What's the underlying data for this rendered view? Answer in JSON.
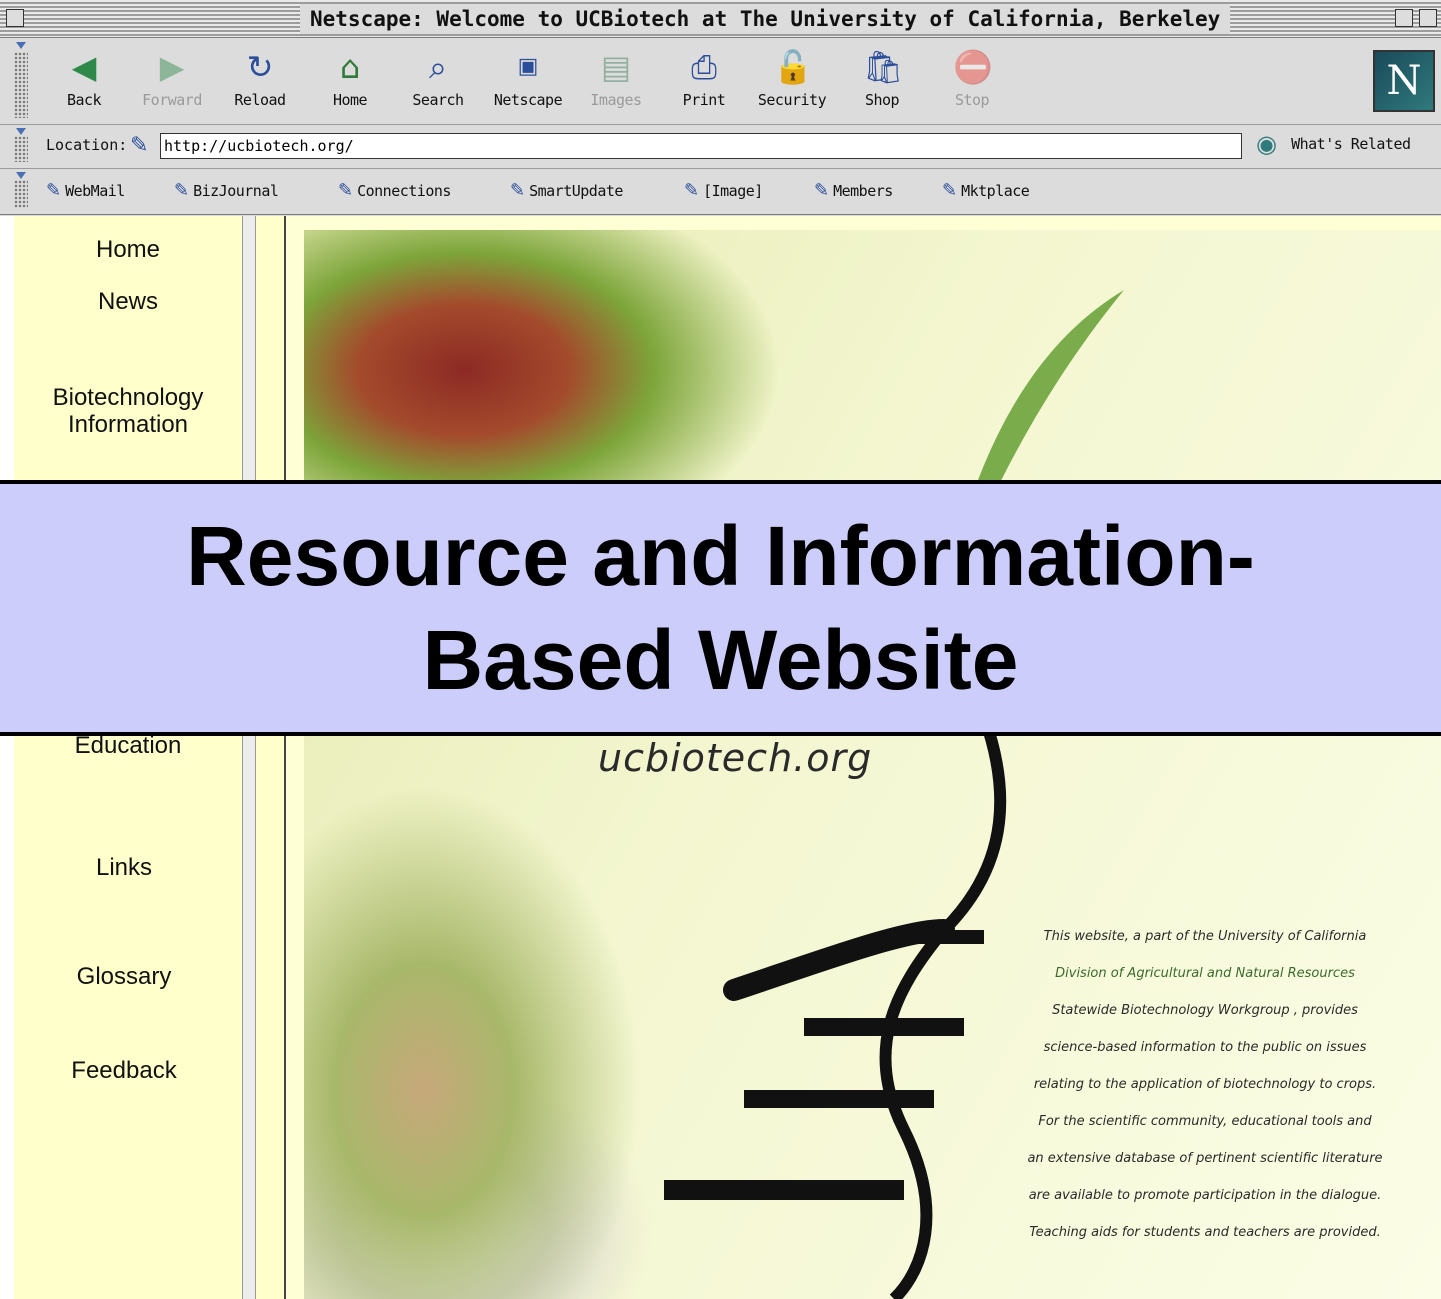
{
  "window": {
    "title": "Netscape: Welcome to UCBiotech at The University of California, Berkeley"
  },
  "toolbar": {
    "buttons": [
      {
        "label": "Back",
        "icon": "back-arrow-icon",
        "enabled": true
      },
      {
        "label": "Forward",
        "icon": "forward-arrow-icon",
        "enabled": false
      },
      {
        "label": "Reload",
        "icon": "reload-icon",
        "enabled": true
      },
      {
        "label": "Home",
        "icon": "home-icon",
        "enabled": true
      },
      {
        "label": "Search",
        "icon": "search-icon",
        "enabled": true
      },
      {
        "label": "Netscape",
        "icon": "my-netscape-icon",
        "enabled": true
      },
      {
        "label": "Images",
        "icon": "images-icon",
        "enabled": false
      },
      {
        "label": "Print",
        "icon": "print-icon",
        "enabled": true
      },
      {
        "label": "Security",
        "icon": "security-lock-icon",
        "enabled": true
      },
      {
        "label": "Shop",
        "icon": "shop-icon",
        "enabled": true
      },
      {
        "label": "Stop",
        "icon": "stop-icon",
        "enabled": false
      }
    ],
    "logo": "N"
  },
  "location": {
    "label": "Location:",
    "url": "http://ucbiotech.org/",
    "related_label": "What's Related"
  },
  "personal_toolbar": {
    "items": [
      "WebMail",
      "BizJournal",
      "Connections",
      "SmartUpdate",
      "[Image]",
      "Members",
      "Mktplace"
    ]
  },
  "sidebar": {
    "items": [
      "Home",
      "News",
      "Biotechnology Information",
      "Education",
      "Links",
      "Glossary",
      "Feedback"
    ]
  },
  "main": {
    "site_name": "ucbiotech.org",
    "description": [
      "This website, a part of the University of California",
      "Division of Agricultural and Natural Resources",
      "Statewide Biotechnology Workgroup , provides",
      "science-based information to the public on issues",
      "relating to the application of biotechnology to crops.",
      "For the scientific community, educational tools and",
      "an extensive database of pertinent scientific literature",
      "are available to promote participation in the dialogue.",
      "Teaching aids for students and teachers are provided."
    ]
  },
  "overlay": {
    "line1": "Resource and Information-",
    "line2": "Based Website"
  },
  "colors": {
    "overlay_bg": "#cdcdfb",
    "sidebar_bg": "#ffffcc",
    "accent_green": "#3b6b2c"
  }
}
